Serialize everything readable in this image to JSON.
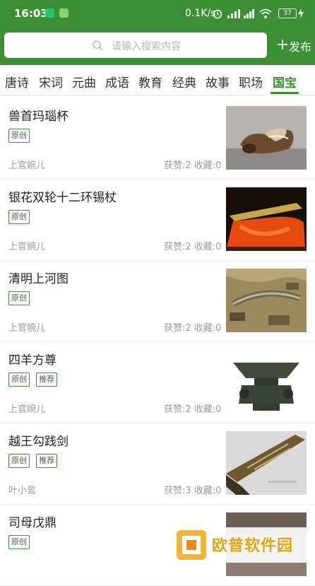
{
  "status_bar": {
    "time": "16:03",
    "network_speed": "0.1K/s",
    "battery": "37"
  },
  "search": {
    "placeholder": "请输入搜索内容"
  },
  "header": {
    "publish_label": "发布"
  },
  "tabs": [
    {
      "label": "唐诗"
    },
    {
      "label": "宋词"
    },
    {
      "label": "元曲"
    },
    {
      "label": "成语"
    },
    {
      "label": "教育"
    },
    {
      "label": "经典"
    },
    {
      "label": "故事"
    },
    {
      "label": "职场"
    },
    {
      "label": "国宝",
      "active": true
    }
  ],
  "items": [
    {
      "title": "兽首玛瑙杯",
      "tags": [
        "原创"
      ],
      "author": "上官婉儿",
      "stats": "获赞:2 收藏:0"
    },
    {
      "title": "银花双轮十二环锡杖",
      "tags": [
        "原创"
      ],
      "author": "上官婉儿",
      "stats": "获赞:2 收藏:0"
    },
    {
      "title": "清明上河图",
      "tags": [
        "原创"
      ],
      "author": "上官婉儿",
      "stats": "获赞:2 收藏:0"
    },
    {
      "title": "四羊方尊",
      "tags": [
        "原创",
        "推荐"
      ],
      "author": "上官婉儿",
      "stats": "获赞:2 收藏:0"
    },
    {
      "title": "越王勾践剑",
      "tags": [
        "原创",
        "推荐"
      ],
      "author": "叶小鸾",
      "stats": "获赞:3 收藏:0"
    },
    {
      "title": "司母戊鼎",
      "tags": [
        "原创"
      ],
      "author": "",
      "stats": ""
    }
  ],
  "watermark": {
    "text": "欧普软件园"
  },
  "colors": {
    "brand_green": "#3c8f34",
    "tag_border": "#3c8f34"
  }
}
